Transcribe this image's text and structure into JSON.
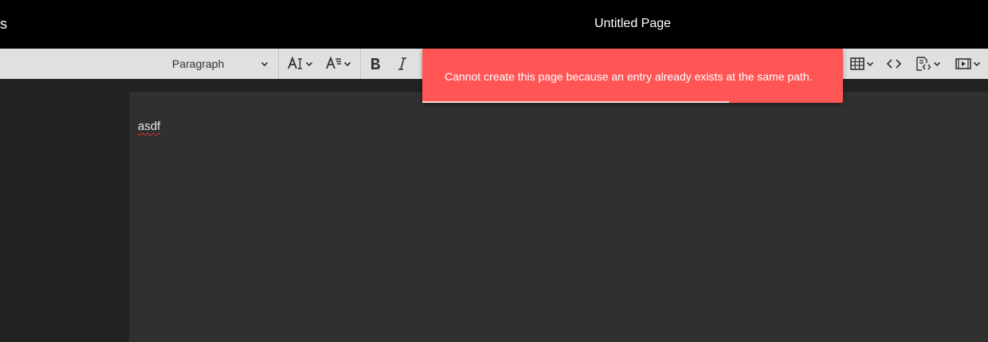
{
  "header": {
    "left_text": "s",
    "page_title": "Untitled Page"
  },
  "toolbar": {
    "block_format": {
      "selected": "Paragraph"
    },
    "icons": [
      "font-size-icon",
      "text-format-icon",
      "bold-icon",
      "italic-icon",
      "table-icon",
      "code-icon",
      "code-block-icon",
      "media-icon"
    ]
  },
  "editor": {
    "content": "asdf",
    "spellcheck_flagged": true
  },
  "notification": {
    "message": "Cannot create this page because an entry already exists at the same path.",
    "type": "error",
    "timer_remaining": 0.73
  },
  "colors": {
    "header_bg": "#000000",
    "toolbar_bg": "#e0e0e0",
    "editor_bg": "#303030",
    "sidebar_bg": "#222222",
    "toast_bg": "#ff5555"
  }
}
